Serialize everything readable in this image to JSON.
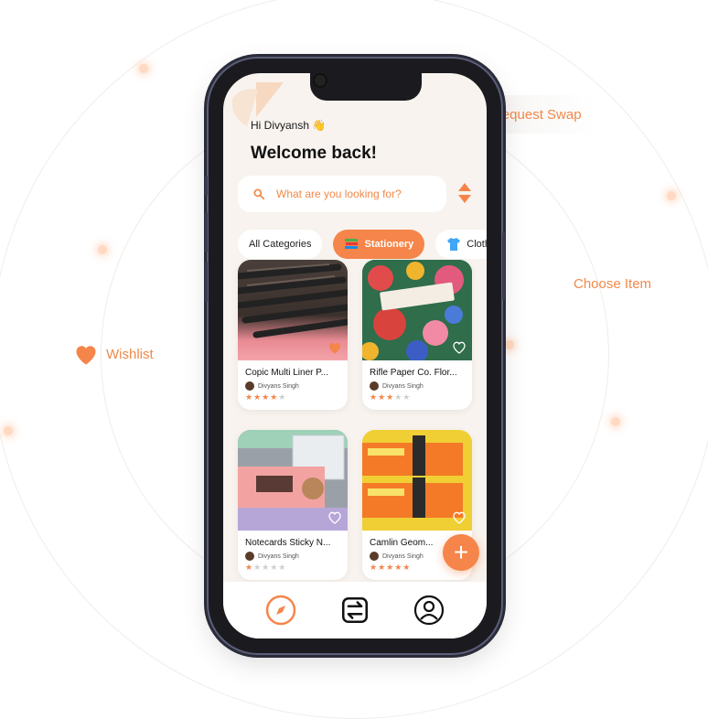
{
  "floating_labels": {
    "request_swap": "Request Swap",
    "choose_item": "Choose Item",
    "wishlist": "Wishlist"
  },
  "app": {
    "greeting": "Hi Divyansh 👋",
    "welcome": "Welcome back!",
    "search": {
      "placeholder": "What are you looking for?"
    },
    "categories": [
      {
        "label": "All Categories",
        "icon": "none",
        "active": false
      },
      {
        "label": "Stationery",
        "icon": "books-icon",
        "active": true
      },
      {
        "label": "Cloth",
        "icon": "shirt-icon",
        "active": false
      }
    ],
    "products": [
      {
        "name": "Copic Multi Liner P...",
        "owner": "Divyans Singh",
        "rating": 4,
        "wishlisted": true
      },
      {
        "name": "Rifle Paper Co. Flor...",
        "owner": "Divyans Singh",
        "rating": 3,
        "wishlisted": false
      },
      {
        "name": "Notecards Sticky N...",
        "owner": "Divyans Singh",
        "rating": 1,
        "wishlisted": false
      },
      {
        "name": "Camlin Geom...",
        "owner": "Divyans Singh",
        "rating": 5,
        "wishlisted": false
      }
    ],
    "fab": "+",
    "tabs": [
      "compass-icon",
      "swap-icon",
      "profile-icon"
    ]
  },
  "colors": {
    "accent": "#f5854a",
    "background": "#f8f3ee"
  }
}
